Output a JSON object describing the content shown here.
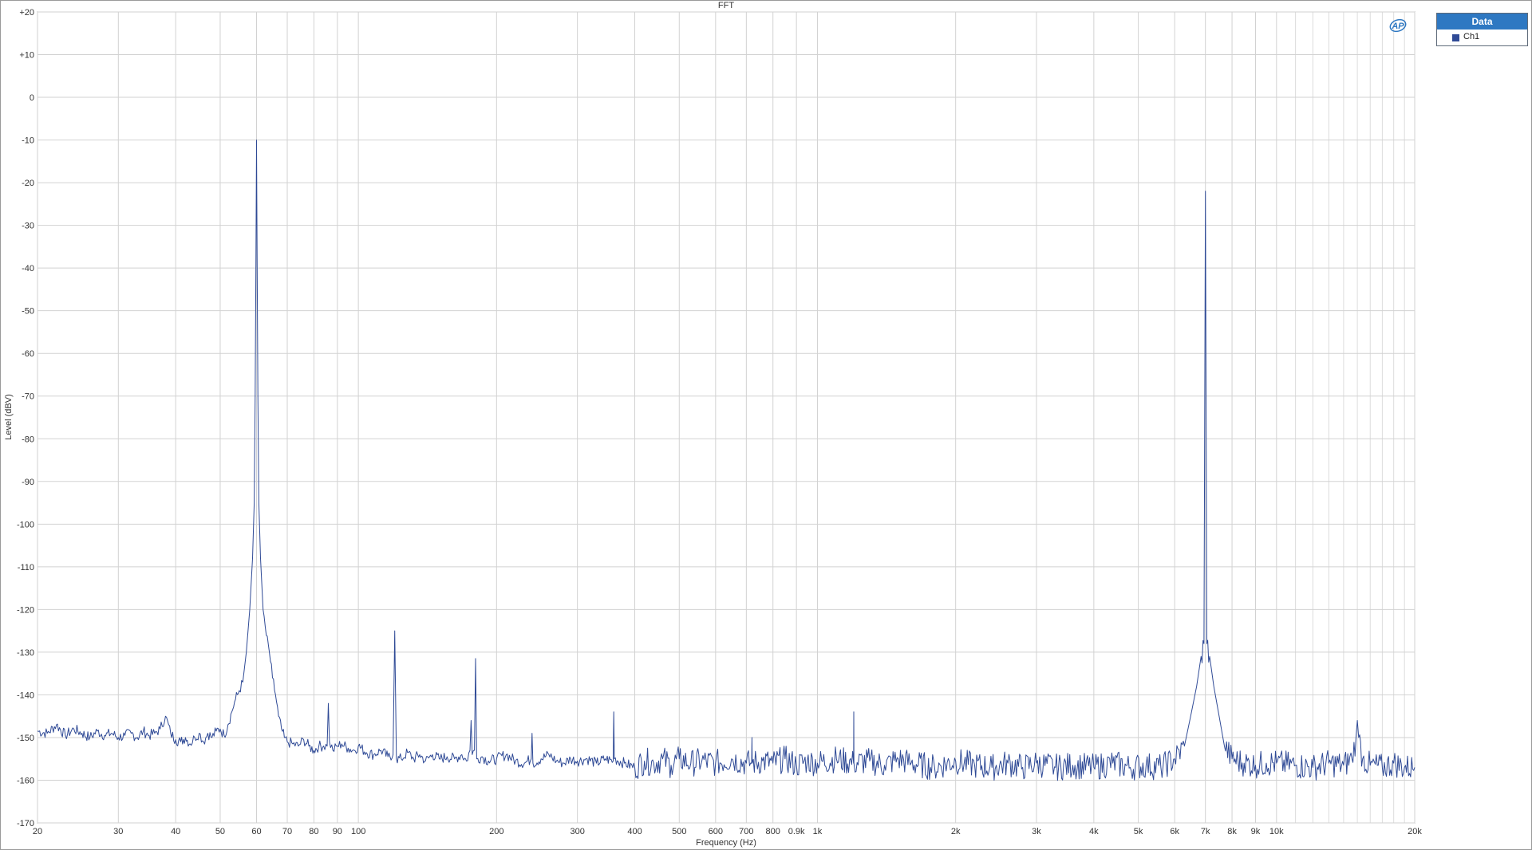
{
  "chart_data": {
    "type": "line",
    "title": "FFT",
    "xlabel": "Frequency (Hz)",
    "ylabel": "Level (dBV)",
    "xscale": "log",
    "xlim": [
      20,
      20000
    ],
    "ylim": [
      -170,
      20
    ],
    "grid": true,
    "legend": {
      "title": "Data",
      "placement": "top-right outside plot"
    },
    "x_ticks": [
      {
        "value": 20,
        "label": "20"
      },
      {
        "value": 30,
        "label": "30"
      },
      {
        "value": 40,
        "label": "40"
      },
      {
        "value": 50,
        "label": "50"
      },
      {
        "value": 60,
        "label": "60"
      },
      {
        "value": 70,
        "label": "70"
      },
      {
        "value": 80,
        "label": "80"
      },
      {
        "value": 90,
        "label": "90"
      },
      {
        "value": 100,
        "label": "100"
      },
      {
        "value": 200,
        "label": "200"
      },
      {
        "value": 300,
        "label": "300"
      },
      {
        "value": 400,
        "label": "400"
      },
      {
        "value": 500,
        "label": "500"
      },
      {
        "value": 600,
        "label": "600"
      },
      {
        "value": 700,
        "label": "700"
      },
      {
        "value": 800,
        "label": "800"
      },
      {
        "value": 900,
        "label": "0.9k"
      },
      {
        "value": 1000,
        "label": "1k"
      },
      {
        "value": 2000,
        "label": "2k"
      },
      {
        "value": 3000,
        "label": "3k"
      },
      {
        "value": 4000,
        "label": "4k"
      },
      {
        "value": 5000,
        "label": "5k"
      },
      {
        "value": 6000,
        "label": "6k"
      },
      {
        "value": 7000,
        "label": "7k"
      },
      {
        "value": 8000,
        "label": "8k"
      },
      {
        "value": 9000,
        "label": "9k"
      },
      {
        "value": 10000,
        "label": "10k"
      },
      {
        "value": 20000,
        "label": "20k"
      }
    ],
    "y_ticks": [
      {
        "value": 20,
        "label": "+20"
      },
      {
        "value": 10,
        "label": "+10"
      },
      {
        "value": 0,
        "label": "0"
      },
      {
        "value": -10,
        "label": "-10"
      },
      {
        "value": -20,
        "label": "-20"
      },
      {
        "value": -30,
        "label": "-30"
      },
      {
        "value": -40,
        "label": "-40"
      },
      {
        "value": -50,
        "label": "-50"
      },
      {
        "value": -60,
        "label": "-60"
      },
      {
        "value": -70,
        "label": "-70"
      },
      {
        "value": -80,
        "label": "-80"
      },
      {
        "value": -90,
        "label": "-90"
      },
      {
        "value": -100,
        "label": "-100"
      },
      {
        "value": -110,
        "label": "-110"
      },
      {
        "value": -120,
        "label": "-120"
      },
      {
        "value": -130,
        "label": "-130"
      },
      {
        "value": -140,
        "label": "-140"
      },
      {
        "value": -150,
        "label": "-150"
      },
      {
        "value": -160,
        "label": "-160"
      },
      {
        "value": -170,
        "label": "-170"
      }
    ],
    "series": [
      {
        "name": "Ch1",
        "color": "#2f4a96",
        "points": [
          [
            20,
            -148.5
          ],
          [
            21,
            -149
          ],
          [
            22,
            -147
          ],
          [
            23,
            -149.5
          ],
          [
            24,
            -148
          ],
          [
            25,
            -149
          ],
          [
            26,
            -150
          ],
          [
            27,
            -148.5
          ],
          [
            28,
            -149.5
          ],
          [
            29,
            -149
          ],
          [
            30,
            -150
          ],
          [
            31,
            -149.5
          ],
          [
            32,
            -149
          ],
          [
            33,
            -150
          ],
          [
            34,
            -148.5
          ],
          [
            35,
            -149.5
          ],
          [
            36,
            -149
          ],
          [
            37,
            -148
          ],
          [
            38,
            -145
          ],
          [
            39,
            -149
          ],
          [
            40,
            -150.5
          ],
          [
            41,
            -151
          ],
          [
            42,
            -150
          ],
          [
            43,
            -151.5
          ],
          [
            44,
            -150
          ],
          [
            45,
            -149
          ],
          [
            46,
            -151
          ],
          [
            47,
            -149
          ],
          [
            48,
            -150
          ],
          [
            49,
            -148.5
          ],
          [
            50,
            -148
          ],
          [
            51,
            -149.5
          ],
          [
            52,
            -147
          ],
          [
            53,
            -144
          ],
          [
            54,
            -141
          ],
          [
            55,
            -139
          ],
          [
            56,
            -137
          ],
          [
            57,
            -130
          ],
          [
            58,
            -120
          ],
          [
            58.8,
            -108
          ],
          [
            59.3,
            -95
          ],
          [
            59.6,
            -70
          ],
          [
            59.8,
            -40
          ],
          [
            60,
            -10
          ],
          [
            60.2,
            -40
          ],
          [
            60.4,
            -70
          ],
          [
            60.7,
            -95
          ],
          [
            61.2,
            -108
          ],
          [
            62,
            -120
          ],
          [
            63,
            -126
          ],
          [
            64,
            -130
          ],
          [
            65,
            -136
          ],
          [
            66,
            -140
          ],
          [
            67,
            -145
          ],
          [
            68,
            -148
          ],
          [
            69,
            -150
          ],
          [
            70,
            -151
          ],
          [
            72,
            -151.5
          ],
          [
            74,
            -152
          ],
          [
            76,
            -150.5
          ],
          [
            78,
            -152
          ],
          [
            80,
            -153
          ],
          [
            82,
            -152
          ],
          [
            84,
            -152
          ],
          [
            85.5,
            -152
          ],
          [
            86,
            -142
          ],
          [
            86.5,
            -151
          ],
          [
            88,
            -153
          ],
          [
            90,
            -152
          ],
          [
            92,
            -151.5
          ],
          [
            95,
            -152.5
          ],
          [
            98,
            -153
          ],
          [
            100,
            -152
          ],
          [
            104,
            -153.5
          ],
          [
            108,
            -154
          ],
          [
            112,
            -153
          ],
          [
            116,
            -154.5
          ],
          [
            119,
            -154
          ],
          [
            120,
            -125
          ],
          [
            121,
            -155
          ],
          [
            124,
            -155
          ],
          [
            128,
            -153.5
          ],
          [
            132,
            -155
          ],
          [
            136,
            -154
          ],
          [
            140,
            -155.5
          ],
          [
            145,
            -154
          ],
          [
            150,
            -155
          ],
          [
            156,
            -154.5
          ],
          [
            162,
            -155
          ],
          [
            168,
            -154
          ],
          [
            172,
            -155.5
          ],
          [
            175,
            -153
          ],
          [
            176,
            -146
          ],
          [
            177,
            -154
          ],
          [
            179,
            -153
          ],
          [
            180,
            -131.5
          ],
          [
            181,
            -155
          ],
          [
            186,
            -154.5
          ],
          [
            192,
            -155.5
          ],
          [
            200,
            -155
          ],
          [
            210,
            -154
          ],
          [
            220,
            -155.5
          ],
          [
            230,
            -156
          ],
          [
            238,
            -155
          ],
          [
            239,
            -149
          ],
          [
            240,
            -156
          ],
          [
            250,
            -155
          ],
          [
            260,
            -154
          ],
          [
            270,
            -155.5
          ],
          [
            280,
            -156
          ],
          [
            290,
            -155
          ],
          [
            300,
            -155.5
          ],
          [
            315,
            -155
          ],
          [
            330,
            -156
          ],
          [
            345,
            -155
          ],
          [
            359,
            -155.5
          ],
          [
            360,
            -144
          ],
          [
            361,
            -155
          ],
          [
            380,
            -156
          ],
          [
            400,
            -157
          ],
          [
            420,
            -155.5
          ],
          [
            440,
            -156
          ],
          [
            460,
            -155
          ],
          [
            480,
            -156.5
          ],
          [
            500,
            -155
          ],
          [
            530,
            -156
          ],
          [
            560,
            -155.5
          ],
          [
            600,
            -156
          ],
          [
            650,
            -155
          ],
          [
            700,
            -156
          ],
          [
            719,
            -156
          ],
          [
            720,
            -150
          ],
          [
            721,
            -156
          ],
          [
            760,
            -155.5
          ],
          [
            800,
            -156
          ],
          [
            850,
            -155
          ],
          [
            900,
            -156.5
          ],
          [
            950,
            -155.5
          ],
          [
            1000,
            -156
          ],
          [
            1100,
            -155
          ],
          [
            1199,
            -156
          ],
          [
            1200,
            -144
          ],
          [
            1201,
            -156
          ],
          [
            1300,
            -155.5
          ],
          [
            1400,
            -156.5
          ],
          [
            1500,
            -155
          ],
          [
            1600,
            -156
          ],
          [
            1800,
            -157
          ],
          [
            2000,
            -155.5
          ],
          [
            2200,
            -156.5
          ],
          [
            2400,
            -157
          ],
          [
            2600,
            -156
          ],
          [
            2800,
            -157
          ],
          [
            3000,
            -156
          ],
          [
            3300,
            -157
          ],
          [
            3600,
            -156.5
          ],
          [
            4000,
            -157
          ],
          [
            4400,
            -156
          ],
          [
            4800,
            -157
          ],
          [
            5200,
            -156.5
          ],
          [
            5600,
            -157
          ],
          [
            6000,
            -155
          ],
          [
            6300,
            -152
          ],
          [
            6500,
            -145
          ],
          [
            6700,
            -138
          ],
          [
            6850,
            -131
          ],
          [
            6950,
            -128
          ],
          [
            7000,
            -22
          ],
          [
            7050,
            -128
          ],
          [
            7150,
            -131
          ],
          [
            7300,
            -138
          ],
          [
            7500,
            -145
          ],
          [
            7700,
            -152
          ],
          [
            8000,
            -155
          ],
          [
            8500,
            -156
          ],
          [
            9000,
            -156.5
          ],
          [
            9500,
            -156
          ],
          [
            10000,
            -156
          ],
          [
            11000,
            -156.5
          ],
          [
            12000,
            -157
          ],
          [
            13000,
            -156
          ],
          [
            14000,
            -156.5
          ],
          [
            14600,
            -155
          ],
          [
            14900,
            -150
          ],
          [
            15000,
            -146
          ],
          [
            15100,
            -150
          ],
          [
            15400,
            -155
          ],
          [
            16000,
            -156.5
          ],
          [
            17000,
            -157
          ],
          [
            18000,
            -156
          ],
          [
            19000,
            -157
          ],
          [
            20000,
            -157
          ]
        ]
      }
    ]
  }
}
